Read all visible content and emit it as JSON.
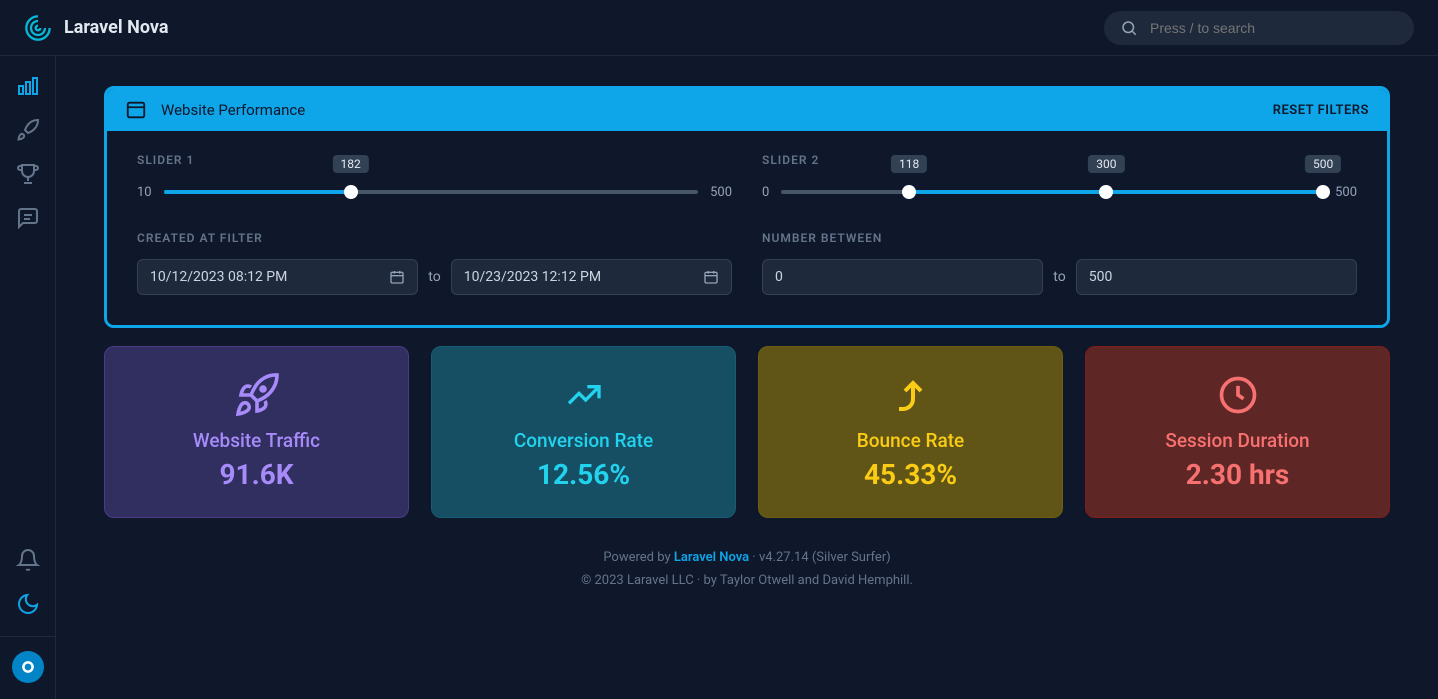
{
  "brand": "Laravel Nova",
  "search": {
    "placeholder": "Press / to search"
  },
  "panel": {
    "title": "Website Performance",
    "reset": "RESET FILTERS",
    "slider1": {
      "label": "SLIDER 1",
      "min": "10",
      "max": "500",
      "value": "182",
      "value_pct": 35
    },
    "slider2": {
      "label": "SLIDER 2",
      "min": "0",
      "max": "500",
      "v1": "118",
      "v1_pct": 23.6,
      "v2": "300",
      "v2_pct": 60,
      "v3": "500",
      "v3_pct": 100
    },
    "created": {
      "label": "CREATED AT FILTER",
      "from": "10/12/2023 08:12 PM",
      "to": "10/23/2023 12:12 PM",
      "sep": "to"
    },
    "between": {
      "label": "NUMBER BETWEEN",
      "from": "0",
      "to": "500",
      "sep": "to"
    }
  },
  "metrics": [
    {
      "title": "Website Traffic",
      "value": "91.6K"
    },
    {
      "title": "Conversion Rate",
      "value": "12.56%"
    },
    {
      "title": "Bounce Rate",
      "value": "45.33%"
    },
    {
      "title": "Session Duration",
      "value": "2.30 hrs"
    }
  ],
  "footer": {
    "powered_pre": "Powered by ",
    "link": "Laravel Nova",
    "version": " · v4.27.14 (Silver Surfer)",
    "copyright": "© 2023 Laravel LLC · by Taylor Otwell and David Hemphill."
  }
}
